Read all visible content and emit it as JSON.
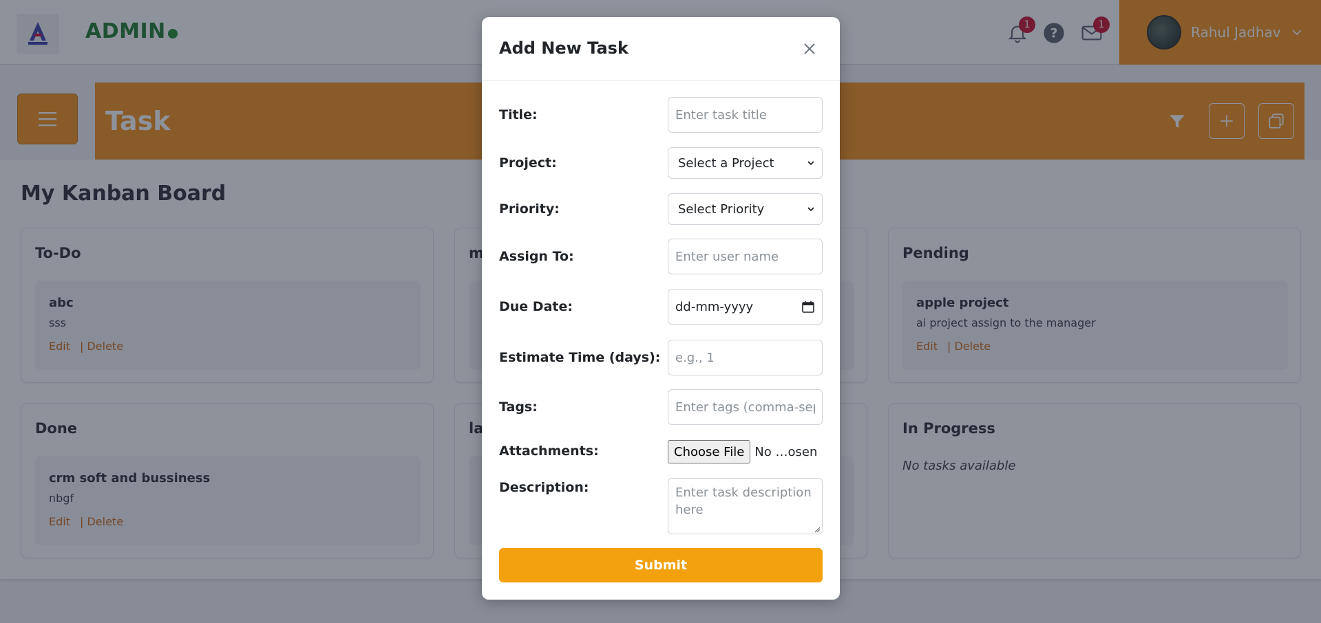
{
  "header": {
    "admin_label": "ADMIN",
    "notifications_badge": "1",
    "messages_badge": "1",
    "user_name": "Rahul Jadhav",
    "logo_icon": "logo-icon",
    "bell_icon": "bell-icon",
    "help_icon": "help-icon",
    "mail_icon": "mail-icon",
    "status_color": "#1f8a32",
    "accent_color": "#f3901b"
  },
  "banner": {
    "title": "Task",
    "menu_icon": "hamburger-icon",
    "filter_icon": "filter-icon",
    "add_icon": "plus-icon",
    "copy_icon": "copy-icon"
  },
  "board": {
    "title": "My Kanban Board",
    "columns": [
      {
        "title": "To-Do",
        "tasks": [
          {
            "title": "abc",
            "description": "sss",
            "edit_label": "Edit",
            "delete_label": "| Delete"
          }
        ]
      },
      {
        "title": "m",
        "tasks": []
      },
      {
        "title": "Pending",
        "tasks": [
          {
            "title": "apple project",
            "description": "ai project assign to the manager",
            "edit_label": "Edit",
            "delete_label": "| Delete"
          }
        ]
      },
      {
        "title": "Done",
        "tasks": [
          {
            "title": "crm soft and bussiness",
            "description": "nbgf",
            "edit_label": "Edit",
            "delete_label": "| Delete"
          }
        ]
      },
      {
        "title": "la",
        "tasks": []
      },
      {
        "title": "In Progress",
        "tasks": [],
        "empty_message": "No tasks available"
      }
    ]
  },
  "modal": {
    "title": "Add New Task",
    "close_icon": "close-icon",
    "fields": {
      "title": {
        "label": "Title:",
        "placeholder": "Enter task title",
        "value": ""
      },
      "project": {
        "label": "Project:",
        "selected": "Select a Project"
      },
      "priority": {
        "label": "Priority:",
        "selected": "Select Priority"
      },
      "assign_to": {
        "label": "Assign To:",
        "placeholder": "Enter user name",
        "value": ""
      },
      "due_date": {
        "label": "Due Date:",
        "value": "dd-mm-yyyy",
        "icon": "calendar-icon"
      },
      "estimate": {
        "label": "Estimate Time (days):",
        "placeholder": "e.g., 1",
        "value": ""
      },
      "tags": {
        "label": "Tags:",
        "placeholder": "Enter tags (comma-separated)",
        "value": ""
      },
      "attachments": {
        "label": "Attachments:",
        "button_label": "Choose File",
        "status": "No …osen"
      },
      "description": {
        "label": "Description:",
        "placeholder": "Enter task description here",
        "value": ""
      }
    },
    "submit_label": "Submit",
    "submit_color": "#f3a10f"
  }
}
